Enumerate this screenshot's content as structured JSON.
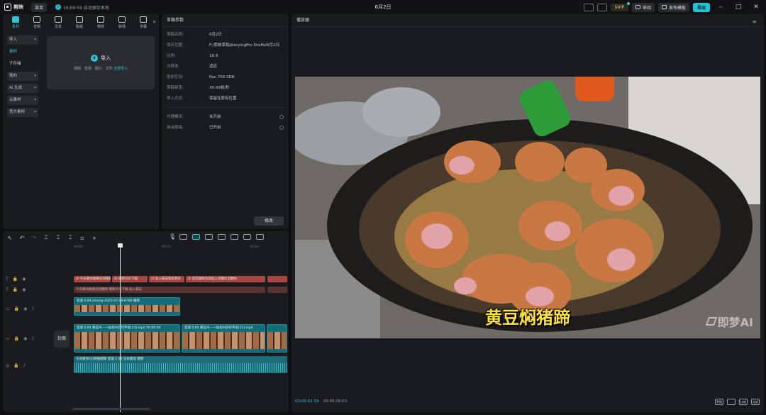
{
  "app": {
    "name": "剪映",
    "menu_label": "菜单",
    "autosave": "16:09:59 自动保存本地",
    "doc_title": "6月2日"
  },
  "topbar": {
    "svip": "SVIP",
    "feedback": "审阅",
    "publish": "发布模板",
    "export": "导出"
  },
  "tool_tabs": [
    {
      "label": "素材",
      "icon": "media-icon"
    },
    {
      "label": "音频",
      "icon": "audio-icon"
    },
    {
      "label": "文本",
      "icon": "text-icon"
    },
    {
      "label": "贴纸",
      "icon": "sticker-icon"
    },
    {
      "label": "特效",
      "icon": "effects-icon"
    },
    {
      "label": "转场",
      "icon": "transition-icon"
    },
    {
      "label": "字幕",
      "icon": "caption-icon"
    }
  ],
  "media_sidebar": [
    "导入",
    "素材",
    "子存储",
    "我的",
    "AI 生成",
    "云素材",
    "官方素材"
  ],
  "import_area": {
    "title": "导入",
    "hint": "视频、音频、图片、文件",
    "link": "全部导入"
  },
  "props": {
    "title": "草稿参数",
    "rows": [
      {
        "k": "草稿名称:",
        "v": "6月2日"
      },
      {
        "k": "保存位置:",
        "v": "F:/剪映草稿/JianyingPro Drafts/6月2日"
      },
      {
        "k": "比例:",
        "v": "16:9"
      },
      {
        "k": "分辨率:",
        "v": "适应"
      },
      {
        "k": "色彩空间:",
        "v": "Rec.709 SDR"
      },
      {
        "k": "草稿帧率:",
        "v": "30.00帧/秒"
      },
      {
        "k": "导入方式:",
        "v": "保留在原有位置"
      }
    ],
    "rows2": [
      {
        "k": "代理模式:",
        "v": "未开启"
      },
      {
        "k": "自由层级:",
        "v": "已开启"
      }
    ],
    "modify": "修改"
  },
  "player": {
    "title": "播放器",
    "subtitle": "黄豆焖猪蹄",
    "watermark": "即梦AI",
    "current_time": "00:00:02:19",
    "total_time": "00:00:26:03",
    "controls": [
      "原图",
      "比例",
      "全屏"
    ]
  },
  "timeline": {
    "ruler": [
      "00:00",
      "00:05",
      "00:10"
    ],
    "text_clips": [
      "AI 今天教你做黄豆焖猪蹄",
      "AI 猪蹄冷水下锅",
      "AI 加入姜蒜葱段煮开",
      "AI 捞出猪蹄洗净加入冰糖炒出糖色"
    ],
    "text_clips2": [
      "今天教你做黄豆焖猪蹄 猪蹄冷水下锅 加入姜蒜"
    ],
    "video_clip1": "变速 0.8X  jimeng-2025-07-08-8766-猪蹄",
    "video_clip2": "变速 0.8X  黄豆AI - 一站式AI创作平台(14).mp4  00:00:04",
    "video_clip3": "变速 0.8X  黄豆AI - 一站式AI创作平台(12).mp4",
    "audio_clip": "今天教你5分钟做猪蹄  变速 1.4X  文本朗读 猪蹄",
    "cover": "封面"
  }
}
